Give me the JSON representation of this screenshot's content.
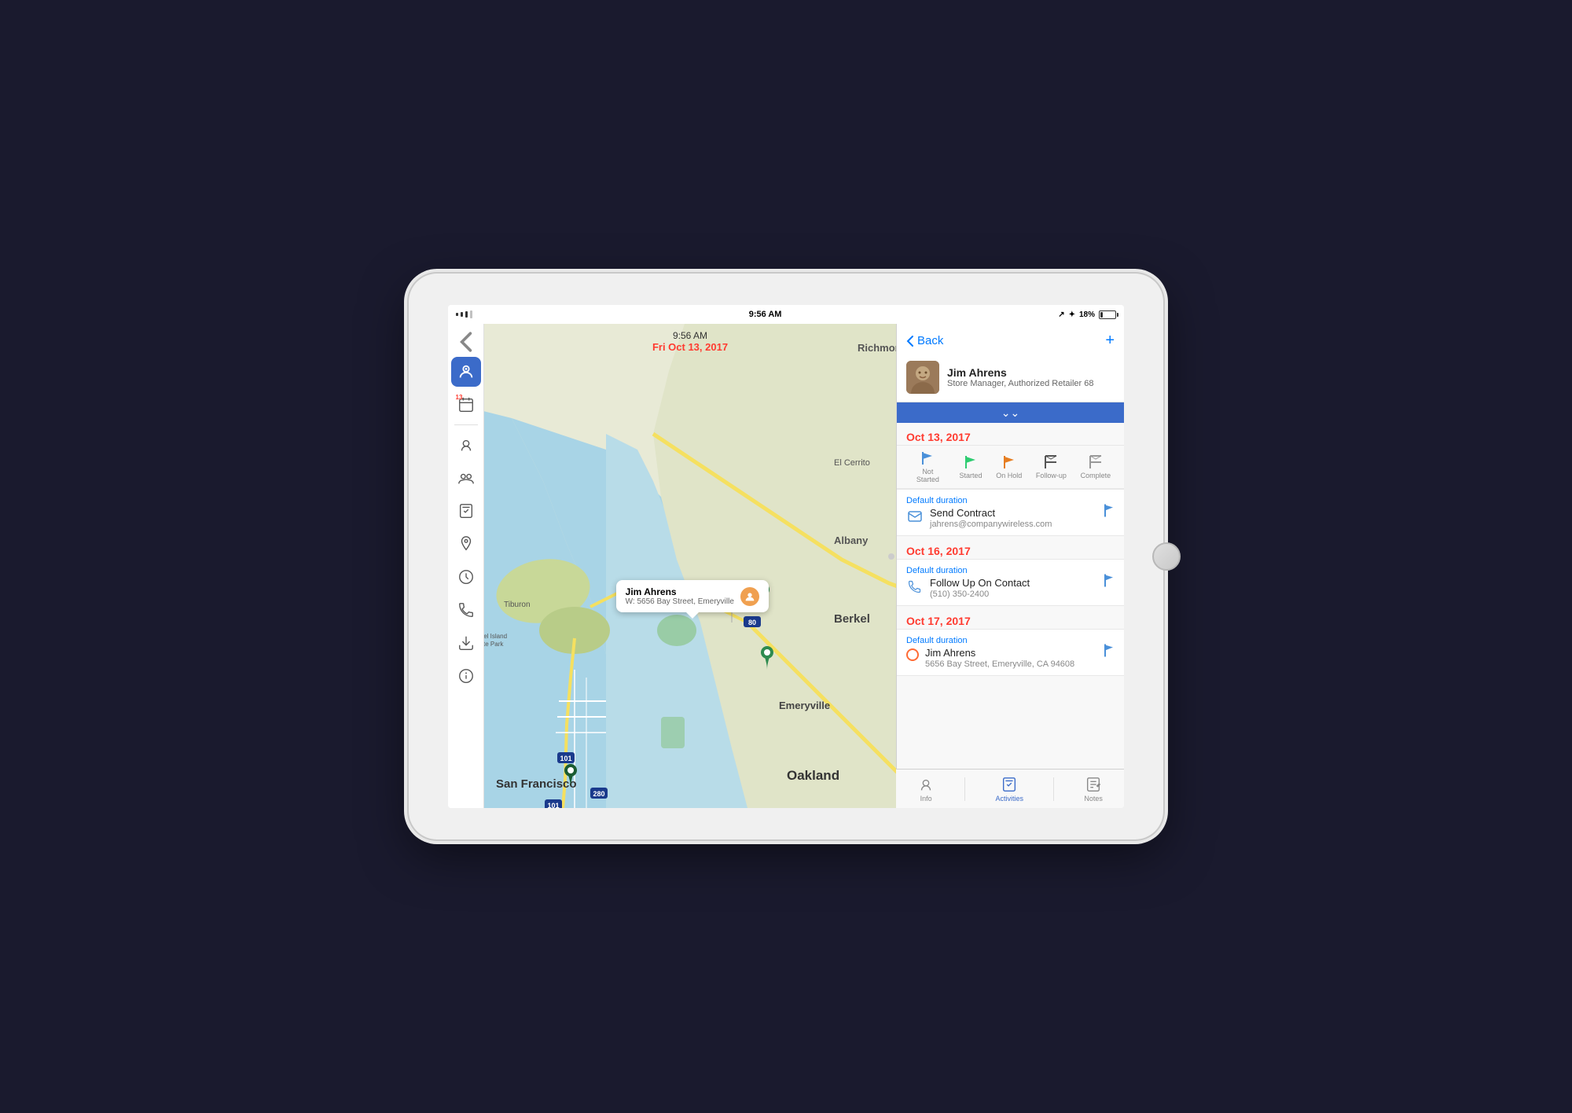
{
  "device": {
    "status_bar": {
      "time": "9:56 AM",
      "date": "Fri Oct 13, 2017",
      "signal_label": "Signal",
      "battery_percent": "18%",
      "bluetooth": true,
      "location": true
    }
  },
  "sidebar": {
    "back_label": "‹",
    "items": [
      {
        "id": "person",
        "label": "Person",
        "active": true
      },
      {
        "id": "calendar",
        "label": "Calendar",
        "badge": "13"
      },
      {
        "id": "contact",
        "label": "Contact"
      },
      {
        "id": "group",
        "label": "Group"
      },
      {
        "id": "checklist",
        "label": "Checklist"
      },
      {
        "id": "location",
        "label": "Location"
      },
      {
        "id": "clock",
        "label": "Clock"
      },
      {
        "id": "phone",
        "label": "Phone"
      },
      {
        "id": "download",
        "label": "Download"
      },
      {
        "id": "info",
        "label": "Info"
      }
    ]
  },
  "map": {
    "time": "9:56 AM",
    "date": "Fri Oct 13, 2017",
    "callout": {
      "name": "Jim Ahrens",
      "address": "W: 5656 Bay Street, Emeryville"
    },
    "pins": [
      {
        "id": "pin1",
        "color": "green",
        "location": "emeryville_1"
      },
      {
        "id": "pin2",
        "color": "green",
        "location": "emeryville_2"
      },
      {
        "id": "pin3",
        "color": "dark_green",
        "location": "san_francisco"
      }
    ]
  },
  "right_panel": {
    "nav": {
      "back_label": "Back",
      "add_label": "+"
    },
    "contact": {
      "name": "Jim Ahrens",
      "title": "Store Manager, Authorized Retailer 68"
    },
    "activities": [
      {
        "id": "act1",
        "date": "Oct 13, 2017",
        "duration": "Default duration",
        "type": "email",
        "title": "Send Contract",
        "subtitle": "jahrens@companywireless.com",
        "flagged": true
      },
      {
        "id": "act2",
        "date": "Oct 16, 2017",
        "duration": "Default duration",
        "type": "phone",
        "title": "Follow Up On Contact",
        "subtitle": "(510) 350-2400",
        "flagged": true
      },
      {
        "id": "act3",
        "date": "Oct 17, 2017",
        "duration": "Default duration",
        "type": "location",
        "title": "Jim Ahrens",
        "subtitle": "5656 Bay Street, Emeryville, CA 94608",
        "flagged": true
      }
    ],
    "status_flags": [
      {
        "id": "not_started",
        "label": "Not Started",
        "icon": "🚩",
        "color": "#4a90d9"
      },
      {
        "id": "started",
        "label": "Started",
        "icon": "🚩",
        "color": "#2ecc71"
      },
      {
        "id": "on_hold",
        "label": "On Hold",
        "icon": "🚩",
        "color": "#e67e22"
      },
      {
        "id": "follow_up",
        "label": "Follow-up",
        "icon": "🏁",
        "color": "#333"
      },
      {
        "id": "complete",
        "label": "Complete",
        "icon": "🏁",
        "color": "#666"
      }
    ],
    "bottom_tabs": [
      {
        "id": "info",
        "label": "Info",
        "active": false
      },
      {
        "id": "activities",
        "label": "Activities",
        "active": true
      },
      {
        "id": "notes",
        "label": "Notes",
        "active": false
      }
    ]
  }
}
